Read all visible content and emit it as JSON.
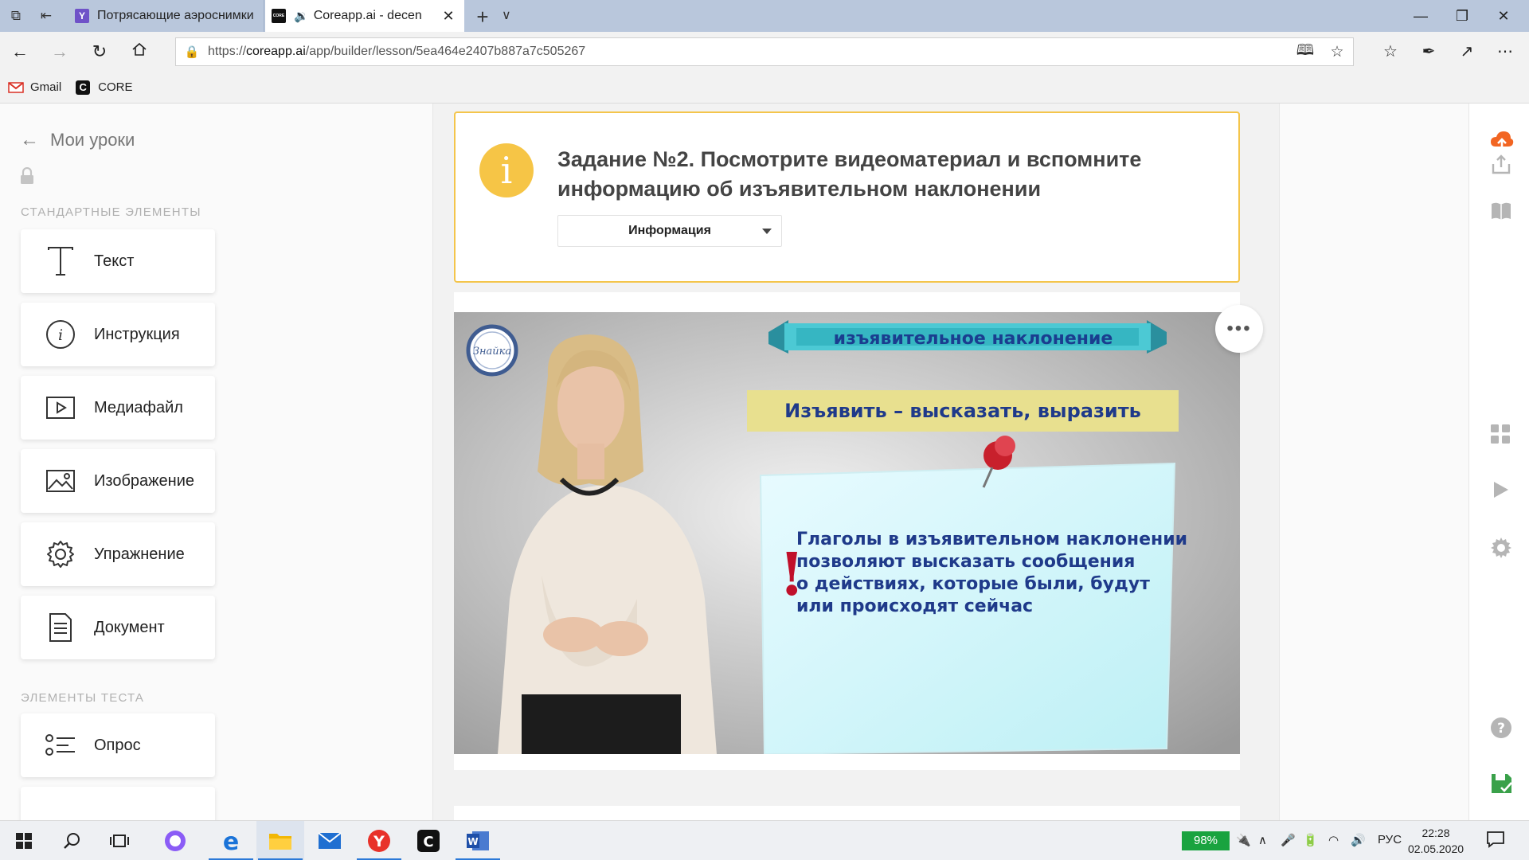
{
  "browser": {
    "tabs": [
      {
        "title": "Потрясающие аэроснимки",
        "favicon": "yandex-favicon"
      },
      {
        "title": "Coreapp.ai - decen",
        "favicon": "core-favicon",
        "audio": true
      }
    ],
    "url_prefix": "https://",
    "url_host": "coreapp.ai",
    "url_path": "/app/builder/lesson/5ea464e2407b887a7c505267",
    "favorites": [
      {
        "label": "Gmail",
        "icon": "gmail-icon"
      },
      {
        "label": "CORE",
        "icon": "core-icon"
      }
    ]
  },
  "sidebar": {
    "back_label": "Мои уроки",
    "section_standard": "СТАНДАРТНЫЕ ЭЛЕМЕНТЫ",
    "standard_items": [
      {
        "label": "Текст",
        "icon": "text-icon"
      },
      {
        "label": "Инструкция",
        "icon": "info-icon"
      },
      {
        "label": "Медиафайл",
        "icon": "play-icon"
      },
      {
        "label": "Изображение",
        "icon": "image-icon"
      },
      {
        "label": "Упражнение",
        "icon": "gear-icon"
      },
      {
        "label": "Документ",
        "icon": "document-icon"
      }
    ],
    "section_test": "ЭЛЕМЕНТЫ ТЕСТА",
    "test_items": [
      {
        "label": "Опрос",
        "icon": "poll-icon"
      }
    ]
  },
  "task": {
    "title": "Задание №2. Посмотрите видеоматериал и вспомните информацию об изъявительном наклонении",
    "type_value": "Информация",
    "info_glyph": "i"
  },
  "video": {
    "logo_text": "Знайка",
    "banner_text": "изъявительное наклонение",
    "definition_text": "Изъявить –  высказать, выразить",
    "note_lines": [
      "Глаголы в изъявительном наклонении",
      "позволяют высказать сообщения",
      "о действиях, которые были, будут",
      "или происходят сейчас"
    ]
  },
  "more_glyph": "•••",
  "right_toolbar": [
    "upload-cloud-icon",
    "share-icon",
    "book-icon",
    "grid-icon",
    "play-icon",
    "settings-icon",
    "help-icon",
    "save-icon"
  ],
  "taskbar": {
    "battery": "98%",
    "language": "РУС",
    "time": "22:28",
    "date": "02.05.2020"
  },
  "colors": {
    "accent_orange": "#f26522",
    "info_yellow": "#f6c546",
    "save_green": "#3aa14a",
    "battery_green": "#19a33f"
  }
}
